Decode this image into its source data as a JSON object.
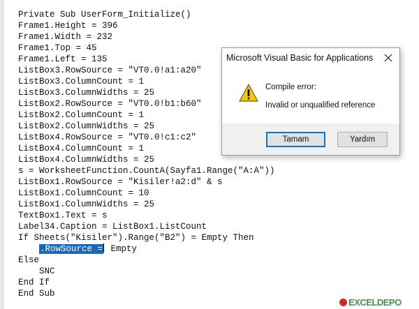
{
  "editor": {
    "lines": [
      "Private Sub UserForm_Initialize()",
      "Frame1.Height = 396",
      "Frame1.Width = 232",
      "Frame1.Top = 45",
      "Frame1.Left = 135",
      "ListBox3.RowSource = \"VT0.0!a1:a20\"",
      "ListBox3.ColumnCount = 1",
      "ListBox3.ColumnWidths = 25",
      "ListBox2.RowSource = \"VT0.0!b1:b60\"",
      "ListBox2.ColumnCount = 1",
      "ListBox2.ColumnWidths = 25",
      "ListBox4.RowSource = \"VT0.0!c1:c2\"",
      "ListBox4.ColumnCount = 1",
      "ListBox4.ColumnWidths = 25",
      "s = WorksheetFunction.CountA(Sayfa1.Range(\"A:A\"))",
      "ListBox1.RowSource = \"Kisiler!a2:d\" & s",
      "ListBox1.ColumnCount = 10",
      "ListBox1.ColumnWidths = 25",
      "TextBox1.Text = s",
      "Label34.Caption = ListBox1.ListCount",
      "If Sheets(\"Kisiler\").Range(\"B2\") = Empty Then"
    ],
    "highlight_line": {
      "indent": "    ",
      "selected": ".RowSource =",
      "rest": " Empty"
    },
    "lines_after": [
      "Else",
      "    SNC",
      "End If",
      "End Sub"
    ]
  },
  "dialog": {
    "title": "Microsoft Visual Basic for Applications",
    "icon": "warning-icon",
    "message_title": "Compile error:",
    "message": "Invalid or unqualified reference",
    "ok_label": "Tamam",
    "help_label": "Yardım"
  },
  "watermark": {
    "text": "EXCELDEPO"
  }
}
